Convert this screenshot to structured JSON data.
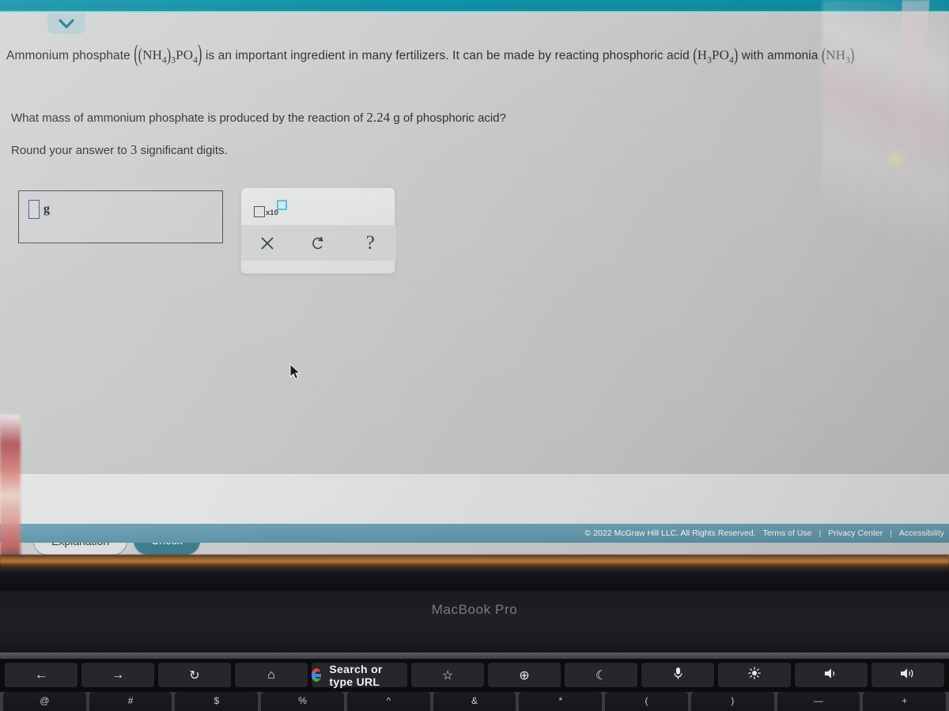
{
  "colors": {
    "teal_topbar": "#0d8fa4",
    "check_button": "#3d7d8c",
    "footer_bar": "#5e94a8",
    "input_border_blue": "#4152a8",
    "exponent_box": "#5bc0d8"
  },
  "browser": {
    "collapse_icon": "chevron-down-icon"
  },
  "problem": {
    "statement": {
      "part1": "Ammonium phosphate",
      "formula1": {
        "open": "(",
        "inner_open": "(",
        "nh4": "NH",
        "nh4_sub": "4",
        "inner_close": ")",
        "subscript3": "3",
        "po4_p": "PO",
        "po4_sub": "4",
        "close": ")"
      },
      "part2": "is an important ingredient in many fertilizers. It can be made by reacting phosphoric acid",
      "formula2": {
        "open": "(",
        "h": "H",
        "h_sub": "3",
        "po4": "PO",
        "po4_sub": "4",
        "close": ")"
      },
      "part3": "with ammonia",
      "formula3": {
        "open": "(",
        "n": "NH",
        "n_sub": "3",
        "close": ")"
      }
    },
    "question_line1_a": "What mass of ammonium phosphate is produced by the reaction of",
    "question_value": "2.24",
    "question_line1_b": "g of phosphoric acid?",
    "question_line2_a": "Round your answer to",
    "question_sigfigs": "3",
    "question_line2_b": "significant digits."
  },
  "answer": {
    "value": "",
    "unit": "g"
  },
  "palette": {
    "scientific_notation": {
      "name": "x10-exponent-button",
      "label": "x10"
    },
    "buttons": [
      {
        "name": "clear-button",
        "glyph": "×"
      },
      {
        "name": "undo-button",
        "glyph": "↺"
      },
      {
        "name": "help-button",
        "glyph": "?"
      }
    ]
  },
  "actions": {
    "explanation": "Explanation",
    "check": "Check"
  },
  "footer": {
    "copyright": "© 2022 McGraw Hill LLC. All Rights Reserved.",
    "links": [
      "Terms of Use",
      "Privacy Center",
      "Accessibility"
    ],
    "separator": "|"
  },
  "laptop": {
    "model_label": "MacBook Pro",
    "touchbar": {
      "keys": [
        {
          "name": "back-icon",
          "glyph": "←"
        },
        {
          "name": "forward-icon",
          "glyph": "→"
        },
        {
          "name": "reload-icon",
          "glyph": "↻"
        },
        {
          "name": "home-icon",
          "glyph": "⌂"
        }
      ],
      "url_label": "Search or type URL",
      "google_icon": "google-g-icon",
      "right_keys": [
        {
          "name": "bookmark-star-icon",
          "glyph": "☆"
        },
        {
          "name": "new-tab-plus-icon",
          "glyph": "⊕"
        },
        {
          "name": "crescent-icon",
          "glyph": "☾"
        },
        {
          "name": "microphone-icon",
          "glyph": "Ἲ4"
        },
        {
          "name": "brightness-icon",
          "glyph": "☀"
        },
        {
          "name": "volume-down-icon",
          "glyph": "ὐ9"
        },
        {
          "name": "volume-up-icon",
          "glyph": "ὐa"
        }
      ]
    },
    "keyboard_row": [
      "@",
      "#",
      "$",
      "%",
      "^",
      "&",
      "*",
      "(",
      ")",
      "—",
      "+"
    ]
  }
}
